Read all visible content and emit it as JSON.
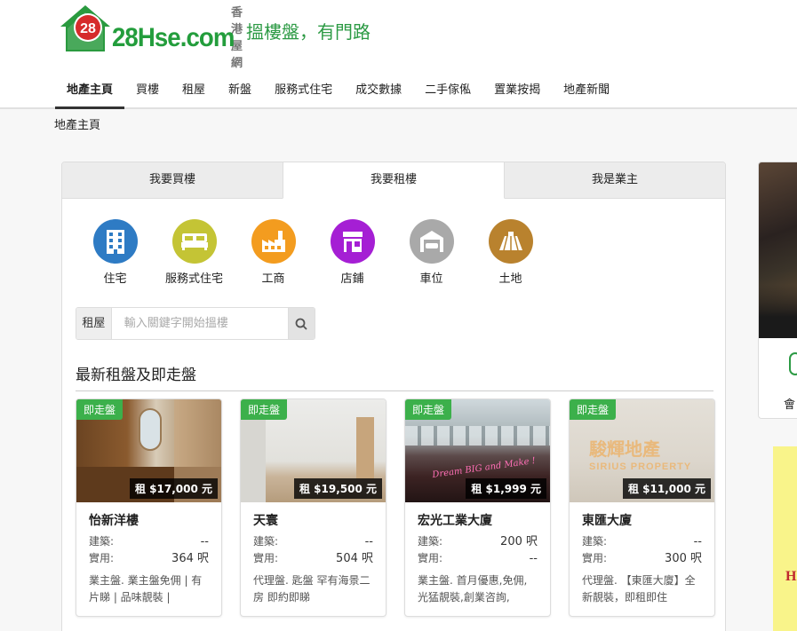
{
  "header": {
    "logo_text": "28Hse.com",
    "logo_badge": "28",
    "logo_sub": "香港屋網",
    "slogan": "搵樓盤，有門路"
  },
  "nav": [
    "地產主頁",
    "買樓",
    "租屋",
    "新盤",
    "服務式住宅",
    "成交數據",
    "二手傢俬",
    "置業按揭",
    "地產新聞"
  ],
  "breadcrumb": "地產主頁",
  "tabs": [
    "我要買樓",
    "我要租樓",
    "我是業主"
  ],
  "categories": [
    {
      "label": "住宅",
      "icon": "building-icon",
      "color": "#2e7bc4"
    },
    {
      "label": "服務式住宅",
      "icon": "bed-icon",
      "color": "#c4c435"
    },
    {
      "label": "工商",
      "icon": "factory-icon",
      "color": "#f39c1f"
    },
    {
      "label": "店鋪",
      "icon": "shop-icon",
      "color": "#a51fd4"
    },
    {
      "label": "車位",
      "icon": "garage-icon",
      "color": "#a9a9a9"
    },
    {
      "label": "土地",
      "icon": "land-icon",
      "color": "#b9822e"
    }
  ],
  "search": {
    "label": "租屋",
    "placeholder": "輸入關鍵字開始搵樓"
  },
  "section_title": "最新租盤及即走盤",
  "cards": [
    {
      "badge": "即走盤",
      "price": "租 $17,000 元",
      "title": "怡新洋樓",
      "gross_label": "建築:",
      "gross": "--",
      "net_label": "實用:",
      "net": "364 呎",
      "desc": "業主盤. 業主盤免佣 | 有片睇 | 品味靚裝 |"
    },
    {
      "badge": "即走盤",
      "price": "租 $19,500 元",
      "title": "天寰",
      "gross_label": "建築:",
      "gross": "--",
      "net_label": "實用:",
      "net": "504 呎",
      "desc": "代理盤. 匙盤 罕有海景二房 即約即睇"
    },
    {
      "badge": "即走盤",
      "price": "租 $1,999 元",
      "title": "宏光工業大廈",
      "gross_label": "建築:",
      "gross": "200 呎",
      "net_label": "實用:",
      "net": "--",
      "desc": "業主盤. 首月優惠,免佣,光猛靚裝,創業咨詢,"
    },
    {
      "badge": "即走盤",
      "price": "租 $11,000 元",
      "title": "東匯大廈",
      "gross_label": "建築:",
      "gross": "--",
      "net_label": "實用:",
      "net": "300 呎",
      "desc": "代理盤. 【東匯大廈】全新靚裝，即租即住"
    }
  ],
  "card_images": {
    "img3_neon": "Dream BIG and Make !",
    "img4_sign_cn": "駿輝地產",
    "img4_sign_en": "SIRIUS PROPERTY"
  },
  "side": {
    "label": "會",
    "ad_text": "H"
  }
}
